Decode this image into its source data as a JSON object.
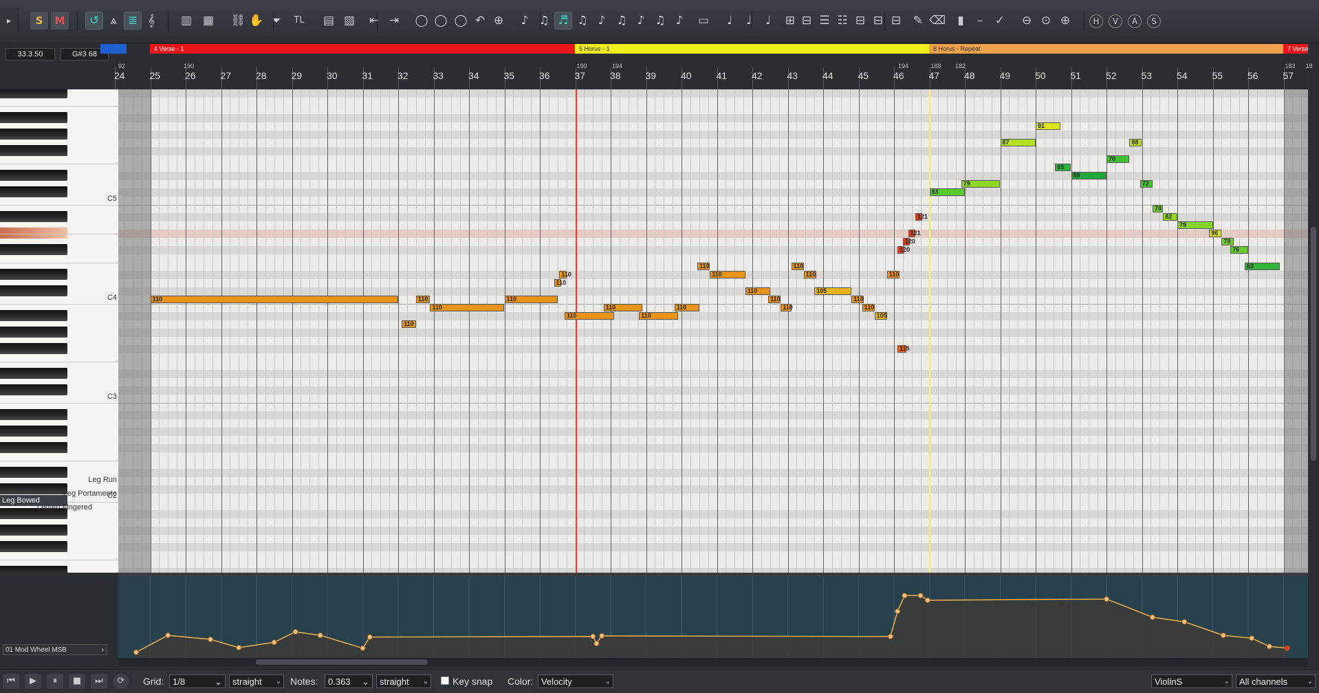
{
  "toolbar": {
    "menu_arrow": "▸",
    "solo_label": "S",
    "mute_label": "M",
    "icons": [
      "loop-icon",
      "metronome-icon",
      "list-icon",
      "clef-icon",
      "piano-icon",
      "keyboard-icon",
      "link-icon",
      "hand-icon",
      "filter-icon",
      "tl-icon",
      "panel-icon",
      "panels-icon",
      "insert-left-icon",
      "insert-right-icon",
      "circle-select-icon",
      "circle-icon",
      "circle-rect-icon",
      "undo-icon",
      "zoom-icon",
      "note-icon",
      "note-quant-icon",
      "note-active-icon",
      "note-3-icon",
      "note-4-icon",
      "note-5-icon",
      "note-6-icon",
      "note-7-icon",
      "note-8-icon",
      "bar-icon",
      "slur-1-icon",
      "slur-2-icon",
      "slur-3-icon",
      "grid-1-icon",
      "grid-2-icon",
      "grid-3-icon",
      "grid-4-icon",
      "grid-5-icon",
      "grid-6-icon",
      "grid-7-icon",
      "pencil-icon",
      "eraser-icon",
      "chart-icon",
      "dash-icon",
      "tick-icon",
      "zoom-out-icon",
      "zoom-fit-icon",
      "zoom-in-icon",
      "h-icon",
      "v-icon",
      "a-icon",
      "s-icon"
    ],
    "tl_text": "TL",
    "letters": {
      "h": "H",
      "v": "V",
      "a": "A",
      "s": "S"
    }
  },
  "position": {
    "time": "33.3.50",
    "note": "G#3  68"
  },
  "markers": [
    {
      "label": "4  Verse - 1",
      "color": "#e8151a"
    },
    {
      "label": "5  Horus - 1",
      "color": "#f2ee1e"
    },
    {
      "label": "6  Horus - Repeat",
      "color": "#f0a14a"
    },
    {
      "label": "7  Verse -",
      "color": "#e8151a"
    }
  ],
  "ruler": {
    "bars": [
      "24",
      "25",
      "26",
      "27",
      "28",
      "29",
      "30",
      "31",
      "32",
      "33",
      "34",
      "35",
      "36",
      "37",
      "38",
      "39",
      "40",
      "41",
      "42",
      "43",
      "44",
      "45",
      "46",
      "47",
      "48",
      "49",
      "50",
      "51",
      "52",
      "53",
      "54",
      "55",
      "56",
      "57"
    ],
    "tempo_labels": [
      "92",
      "190",
      "190",
      "194",
      "194",
      "168",
      "182",
      "183",
      "18"
    ]
  },
  "keyboard": {
    "labels": [
      "C5",
      "C4",
      "C3",
      "C2"
    ],
    "articulations": [
      "Leg Run",
      "Leg Portamento",
      "Leg Bowed",
      "Legato Fingered"
    ]
  },
  "notes_data": [
    {
      "start": 25,
      "end": 32,
      "pitch": 48,
      "vel": "110",
      "color": "#e8941a"
    },
    {
      "start": 32.1,
      "end": 32.5,
      "pitch": 45,
      "vel": "110",
      "color": "#e8941a"
    },
    {
      "start": 32.5,
      "end": 32.9,
      "pitch": 48,
      "vel": "110",
      "color": "#e8941a"
    },
    {
      "start": 32.9,
      "end": 35,
      "pitch": 47,
      "vel": "110",
      "color": "#e8941a"
    },
    {
      "start": 35,
      "end": 36.5,
      "pitch": 48,
      "vel": "110",
      "color": "#e8941a"
    },
    {
      "start": 36.4,
      "end": 36.6,
      "pitch": 50,
      "vel": "110",
      "color": "#e8941a"
    },
    {
      "start": 36.55,
      "end": 36.75,
      "pitch": 51,
      "vel": "110",
      "color": "#e8941a"
    },
    {
      "start": 36.7,
      "end": 38.1,
      "pitch": 46,
      "vel": "110",
      "color": "#e8941a"
    },
    {
      "start": 37.8,
      "end": 38.9,
      "pitch": 47,
      "vel": "110",
      "color": "#e8941a"
    },
    {
      "start": 38.8,
      "end": 39.9,
      "pitch": 46,
      "vel": "110",
      "color": "#e8941a"
    },
    {
      "start": 39.8,
      "end": 40.5,
      "pitch": 47,
      "vel": "110",
      "color": "#e8941a"
    },
    {
      "start": 40.45,
      "end": 40.8,
      "pitch": 52,
      "vel": "110",
      "color": "#e8941a"
    },
    {
      "start": 40.8,
      "end": 41.8,
      "pitch": 51,
      "vel": "110",
      "color": "#e8941a"
    },
    {
      "start": 41.8,
      "end": 42.5,
      "pitch": 49,
      "vel": "110",
      "color": "#e8941a"
    },
    {
      "start": 42.45,
      "end": 42.8,
      "pitch": 48,
      "vel": "110",
      "color": "#e8941a"
    },
    {
      "start": 42.8,
      "end": 43.1,
      "pitch": 47,
      "vel": "110",
      "color": "#e8941a"
    },
    {
      "start": 43.1,
      "end": 43.45,
      "pitch": 52,
      "vel": "110",
      "color": "#e8941a"
    },
    {
      "start": 43.45,
      "end": 43.8,
      "pitch": 51,
      "vel": "110",
      "color": "#e8941a"
    },
    {
      "start": 43.75,
      "end": 44.8,
      "pitch": 49,
      "vel": "105",
      "color": "#e8b41a"
    },
    {
      "start": 44.8,
      "end": 45.15,
      "pitch": 48,
      "vel": "110",
      "color": "#e8941a"
    },
    {
      "start": 45.1,
      "end": 45.45,
      "pitch": 47,
      "vel": "110",
      "color": "#e8941a"
    },
    {
      "start": 45.45,
      "end": 45.8,
      "pitch": 46,
      "vel": "105",
      "color": "#e8b41a"
    },
    {
      "start": 45.8,
      "end": 46.15,
      "pitch": 51,
      "vel": "110",
      "color": "#e8941a"
    },
    {
      "start": 46.1,
      "end": 46.35,
      "pitch": 42,
      "vel": "115",
      "color": "#e8621a"
    },
    {
      "start": 46.1,
      "end": 46.3,
      "pitch": 54,
      "vel": "120",
      "color": "#e83c1a"
    },
    {
      "start": 46.25,
      "end": 46.45,
      "pitch": 55,
      "vel": "120",
      "color": "#e83c1a"
    },
    {
      "start": 46.4,
      "end": 46.6,
      "pitch": 56,
      "vel": "121",
      "color": "#e83c1a"
    },
    {
      "start": 46.6,
      "end": 46.8,
      "pitch": 58,
      "vel": "121",
      "color": "#e83c1a"
    },
    {
      "start": 47,
      "end": 48,
      "pitch": 61,
      "vel": "83",
      "color": "#56cc2a"
    },
    {
      "start": 47.9,
      "end": 49,
      "pitch": 62,
      "vel": "79",
      "color": "#8ed624"
    },
    {
      "start": 49,
      "end": 50,
      "pitch": 67,
      "vel": "87",
      "color": "#b6e022"
    },
    {
      "start": 50,
      "end": 50.7,
      "pitch": 69,
      "vel": "91",
      "color": "#d8e41e"
    },
    {
      "start": 50.55,
      "end": 51,
      "pitch": 64,
      "vel": "65",
      "color": "#28b83a"
    },
    {
      "start": 51,
      "end": 52,
      "pitch": 63,
      "vel": "59",
      "color": "#22a83a"
    },
    {
      "start": 52,
      "end": 52.65,
      "pitch": 65,
      "vel": "70",
      "color": "#40c232"
    },
    {
      "start": 52.65,
      "end": 53,
      "pitch": 67,
      "vel": "88",
      "color": "#c6e020"
    },
    {
      "start": 52.95,
      "end": 53.3,
      "pitch": 62,
      "vel": "72",
      "color": "#48c430"
    },
    {
      "start": 53.3,
      "end": 53.6,
      "pitch": 59,
      "vel": "78",
      "color": "#72d028"
    },
    {
      "start": 53.6,
      "end": 54,
      "pitch": 58,
      "vel": "82",
      "color": "#94d826"
    },
    {
      "start": 54,
      "end": 55,
      "pitch": 57,
      "vel": "79",
      "color": "#82d428"
    },
    {
      "start": 54.9,
      "end": 55.25,
      "pitch": 56,
      "vel": "96",
      "color": "#dadc20"
    },
    {
      "start": 55.25,
      "end": 55.6,
      "pitch": 55,
      "vel": "78",
      "color": "#72d028"
    },
    {
      "start": 55.5,
      "end": 56,
      "pitch": 54,
      "vel": "76",
      "color": "#62cc2a"
    },
    {
      "start": 55.9,
      "end": 56.9,
      "pitch": 52,
      "vel": "63",
      "color": "#30b43a"
    }
  ],
  "cc": {
    "lane_name": "01 Mod Wheel MSB",
    "points": [
      [
        24.6,
        5
      ],
      [
        25.5,
        34
      ],
      [
        26.7,
        27
      ],
      [
        27.5,
        13
      ],
      [
        28.5,
        22
      ],
      [
        29.1,
        40
      ],
      [
        29.8,
        34
      ],
      [
        31,
        12
      ],
      [
        31.2,
        31
      ],
      [
        37.5,
        32
      ],
      [
        37.6,
        20
      ],
      [
        37.75,
        33
      ],
      [
        45.9,
        32
      ],
      [
        46.1,
        75
      ],
      [
        46.3,
        102
      ],
      [
        46.75,
        102
      ],
      [
        46.95,
        94
      ],
      [
        52,
        96
      ],
      [
        53.3,
        65
      ],
      [
        54.2,
        57
      ],
      [
        55.3,
        34
      ],
      [
        56.1,
        29
      ],
      [
        56.6,
        15
      ],
      [
        57.1,
        12
      ]
    ]
  },
  "bottom": {
    "grid_label": "Grid:",
    "grid_value": "1/8",
    "grid_type": "straight",
    "notes_label": "Notes:",
    "notes_value": "0.363",
    "notes_type": "straight",
    "keysnap_label": "Key snap",
    "color_label": "Color:",
    "color_value": "Velocity",
    "instrument": "ViolinS",
    "channels": "All channels"
  }
}
